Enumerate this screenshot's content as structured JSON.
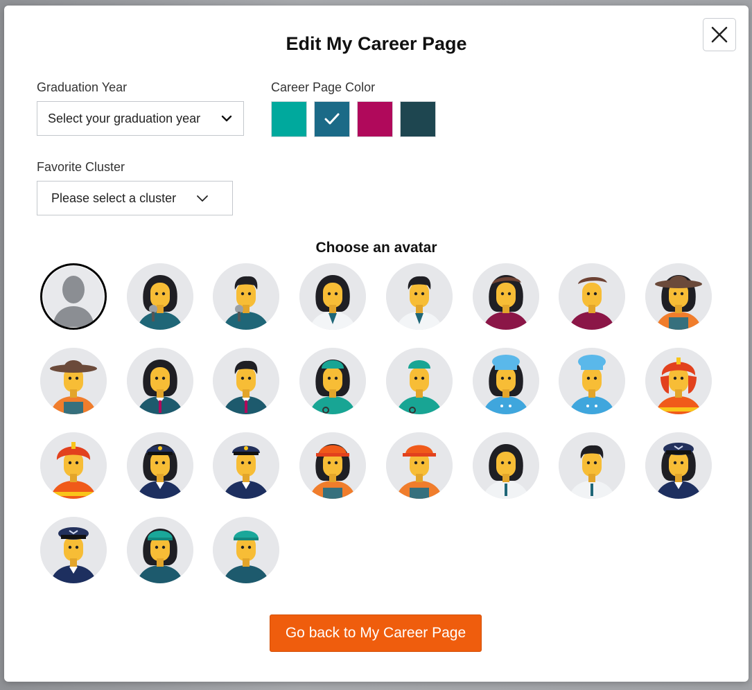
{
  "dialog": {
    "title": "Edit My Career Page",
    "close_icon": "close-icon"
  },
  "graduation": {
    "label": "Graduation Year",
    "placeholder": "Select your graduation year",
    "icon": "chevron-down-icon"
  },
  "color": {
    "label": "Career Page Color",
    "swatches": [
      {
        "name": "teal",
        "hex": "#00a99d",
        "selected": false
      },
      {
        "name": "blue",
        "hex": "#1b6a87",
        "selected": true
      },
      {
        "name": "magenta",
        "hex": "#b0095b",
        "selected": false
      },
      {
        "name": "dark-slate",
        "hex": "#1e4650",
        "selected": false
      }
    ],
    "check_icon": "check-icon"
  },
  "cluster": {
    "label": "Favorite Cluster",
    "placeholder": "Please select a cluster",
    "icon": "chevron-down-icon"
  },
  "avatars": {
    "heading": "Choose an avatar",
    "items": [
      {
        "name": "default-silhouette",
        "selected": true
      },
      {
        "name": "reporter-female"
      },
      {
        "name": "reporter-male"
      },
      {
        "name": "doctor-female"
      },
      {
        "name": "doctor-male"
      },
      {
        "name": "artist-female"
      },
      {
        "name": "artist-male"
      },
      {
        "name": "farmer-female"
      },
      {
        "name": "farmer-male"
      },
      {
        "name": "business-female"
      },
      {
        "name": "business-male"
      },
      {
        "name": "surgeon-female"
      },
      {
        "name": "surgeon-male"
      },
      {
        "name": "chef-female"
      },
      {
        "name": "chef-male"
      },
      {
        "name": "firefighter-female"
      },
      {
        "name": "firefighter-male"
      },
      {
        "name": "police-female"
      },
      {
        "name": "police-male"
      },
      {
        "name": "construction-female"
      },
      {
        "name": "construction-male"
      },
      {
        "name": "office-female"
      },
      {
        "name": "office-male"
      },
      {
        "name": "air-force-female"
      },
      {
        "name": "air-force-male"
      },
      {
        "name": "cap-female"
      },
      {
        "name": "cap-male"
      }
    ]
  },
  "footer": {
    "button_label": "Go back to My Career Page"
  },
  "colors": {
    "accent": "#ef5d0d",
    "skin": "#f7bd36",
    "avatar_bg": "#e6e7ea"
  }
}
